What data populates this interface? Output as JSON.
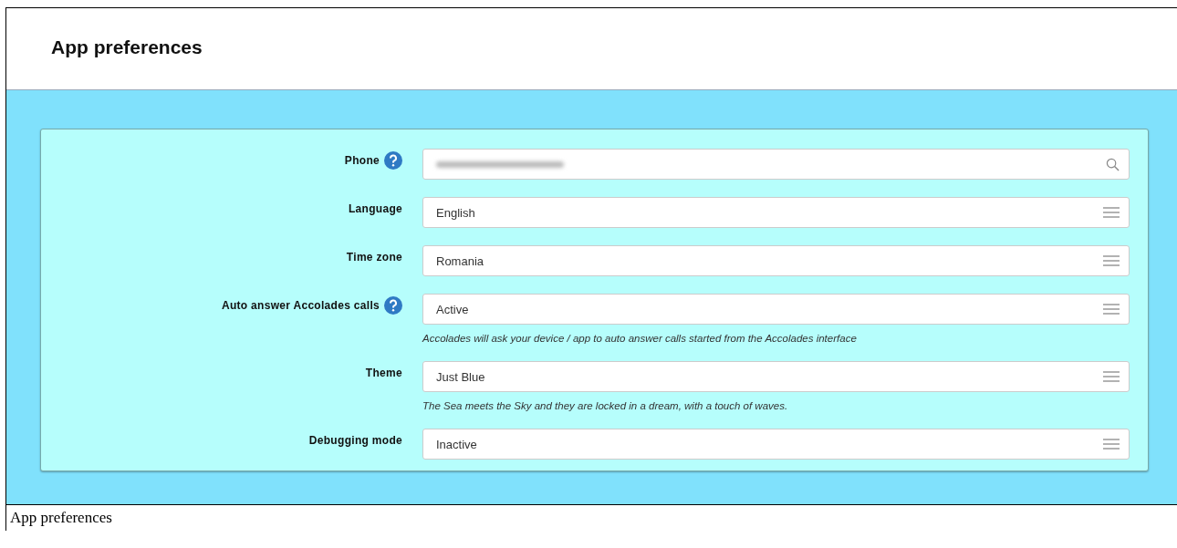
{
  "page": {
    "title": "App preferences"
  },
  "fields": [
    {
      "label": "Phone",
      "help": true,
      "kind": "search",
      "value_blurred": true
    },
    {
      "label": "Language",
      "help": false,
      "kind": "select",
      "value": "English"
    },
    {
      "label": "Time zone",
      "help": false,
      "kind": "select",
      "value": "Romania"
    },
    {
      "label": "Auto answer Accolades calls",
      "help": true,
      "kind": "select",
      "value": "Active",
      "hint": "Accolades will ask your device / app to auto answer calls started from the Accolades interface"
    },
    {
      "label": "Theme",
      "help": false,
      "kind": "select",
      "value": "Just Blue",
      "hint": "The Sea meets the Sky and they are locked in a dream, with a touch of waves."
    },
    {
      "label": "Debugging mode",
      "help": false,
      "kind": "select",
      "value": "Inactive"
    }
  ],
  "caption": "App preferences"
}
